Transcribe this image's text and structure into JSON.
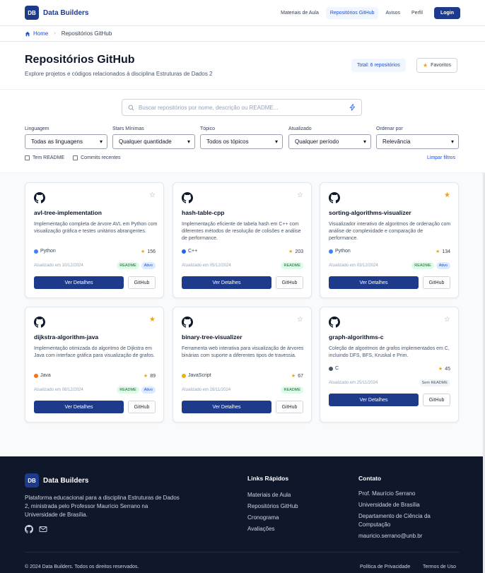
{
  "nav": {
    "logo": "DB",
    "brand": "Data Builders",
    "links": [
      "Materiais de Aula",
      "Repositórios GitHub",
      "Avisos",
      "Perfil"
    ],
    "login": "Login"
  },
  "breadcrumb": {
    "home": "Home",
    "current": "Repositórios GitHub"
  },
  "header": {
    "title": "Repositórios GitHub",
    "subtitle": "Explore projetos e códigos relacionados à disciplina Estruturas de Dados 2",
    "total": "Total: 6 repositórios",
    "favorites": "Favoritos"
  },
  "search": {
    "placeholder": "Buscar repositórios por nome, descrição ou README..."
  },
  "filters": {
    "language": {
      "label": "Linguagem",
      "value": "Todas as linguagens"
    },
    "stars": {
      "label": "Stars Mínimas",
      "value": "Qualquer quantidade"
    },
    "topic": {
      "label": "Tópico",
      "value": "Todos os tópicos"
    },
    "updated": {
      "label": "Atualizado",
      "value": "Qualquer período"
    },
    "sort": {
      "label": "Ordenar por",
      "value": "Relevância"
    },
    "has_readme": "Tem README",
    "recent_commits": "Commits recentes",
    "clear": "Limpar filtros"
  },
  "repos": [
    {
      "name": "avl-tree-implementation",
      "description": "Implementação completa de árvore AVL em Python com visualização gráfica e testes unitários abrangentes.",
      "language": "Python",
      "lang_color": "#3b82f6",
      "stars": "156",
      "updated": "Atualizado em 10/12/2024",
      "favorite": false,
      "badges": [
        "README",
        "Ativo"
      ]
    },
    {
      "name": "hash-table-cpp",
      "description": "Implementação eficiente de tabela hash em C++ com diferentes métodos de resolução de colisões e análise de performance.",
      "language": "C++",
      "lang_color": "#2563eb",
      "stars": "203",
      "updated": "Atualizado em 05/12/2024",
      "favorite": false,
      "badges": [
        "README"
      ]
    },
    {
      "name": "sorting-algorithms-visualizer",
      "description": "Visualizador interativo de algoritmos de ordenação com análise de complexidade e comparação de performance.",
      "language": "Python",
      "lang_color": "#3b82f6",
      "stars": "134",
      "updated": "Atualizado em 03/12/2024",
      "favorite": true,
      "badges": [
        "README",
        "Ativo"
      ]
    },
    {
      "name": "dijkstra-algorithm-java",
      "description": "Implementação otimizada do algoritmo de Dijkstra em Java com interface gráfica para visualização de grafos.",
      "language": "Java",
      "lang_color": "#f97316",
      "stars": "89",
      "updated": "Atualizado em 08/12/2024",
      "favorite": true,
      "badges": [
        "README",
        "Ativo"
      ]
    },
    {
      "name": "binary-tree-visualizer",
      "description": "Ferramenta web interativa para visualização de árvores binárias com suporte a diferentes tipos de travessia.",
      "language": "JavaScript",
      "lang_color": "#eab308",
      "stars": "67",
      "updated": "Atualizado em 28/11/2024",
      "favorite": false,
      "badges": [
        "README"
      ]
    },
    {
      "name": "graph-algorithms-c",
      "description": "Coleção de algoritmos de grafos implementados em C, incluindo DFS, BFS, Kruskal e Prim.",
      "language": "C",
      "lang_color": "#475569",
      "stars": "45",
      "updated": "Atualizado em 25/11/2024",
      "favorite": false,
      "badges": [
        "Sem README"
      ]
    }
  ],
  "card_buttons": {
    "details": "Ver Detalhes",
    "github": "GitHub"
  },
  "footer": {
    "logo": "DB",
    "brand": "Data Builders",
    "description": "Plataforma educacional para a disciplina Estruturas de Dados 2, ministrada pelo Professor Maurício Serrano na Universidade de Brasília.",
    "quick_links_title": "Links Rápidos",
    "quick_links": [
      "Materiais de Aula",
      "Repositórios GitHub",
      "Cronograma",
      "Avaliações"
    ],
    "contact_title": "Contato",
    "contact": [
      "Prof. Maurício Serrano",
      "Universidade de Brasília",
      "Departamento de Ciência da Computação",
      "mauricio.serrano@unb.br"
    ],
    "copyright": "© 2024 Data Builders. Todos os direitos reservados.",
    "privacy": "Política de Privacidade",
    "terms": "Termos de Uso"
  },
  "colors": {
    "primary": "#1e3a8a",
    "accent": "#1d4ed8",
    "star_active": "#f59e0b",
    "footer_bg": "#0f172a"
  }
}
